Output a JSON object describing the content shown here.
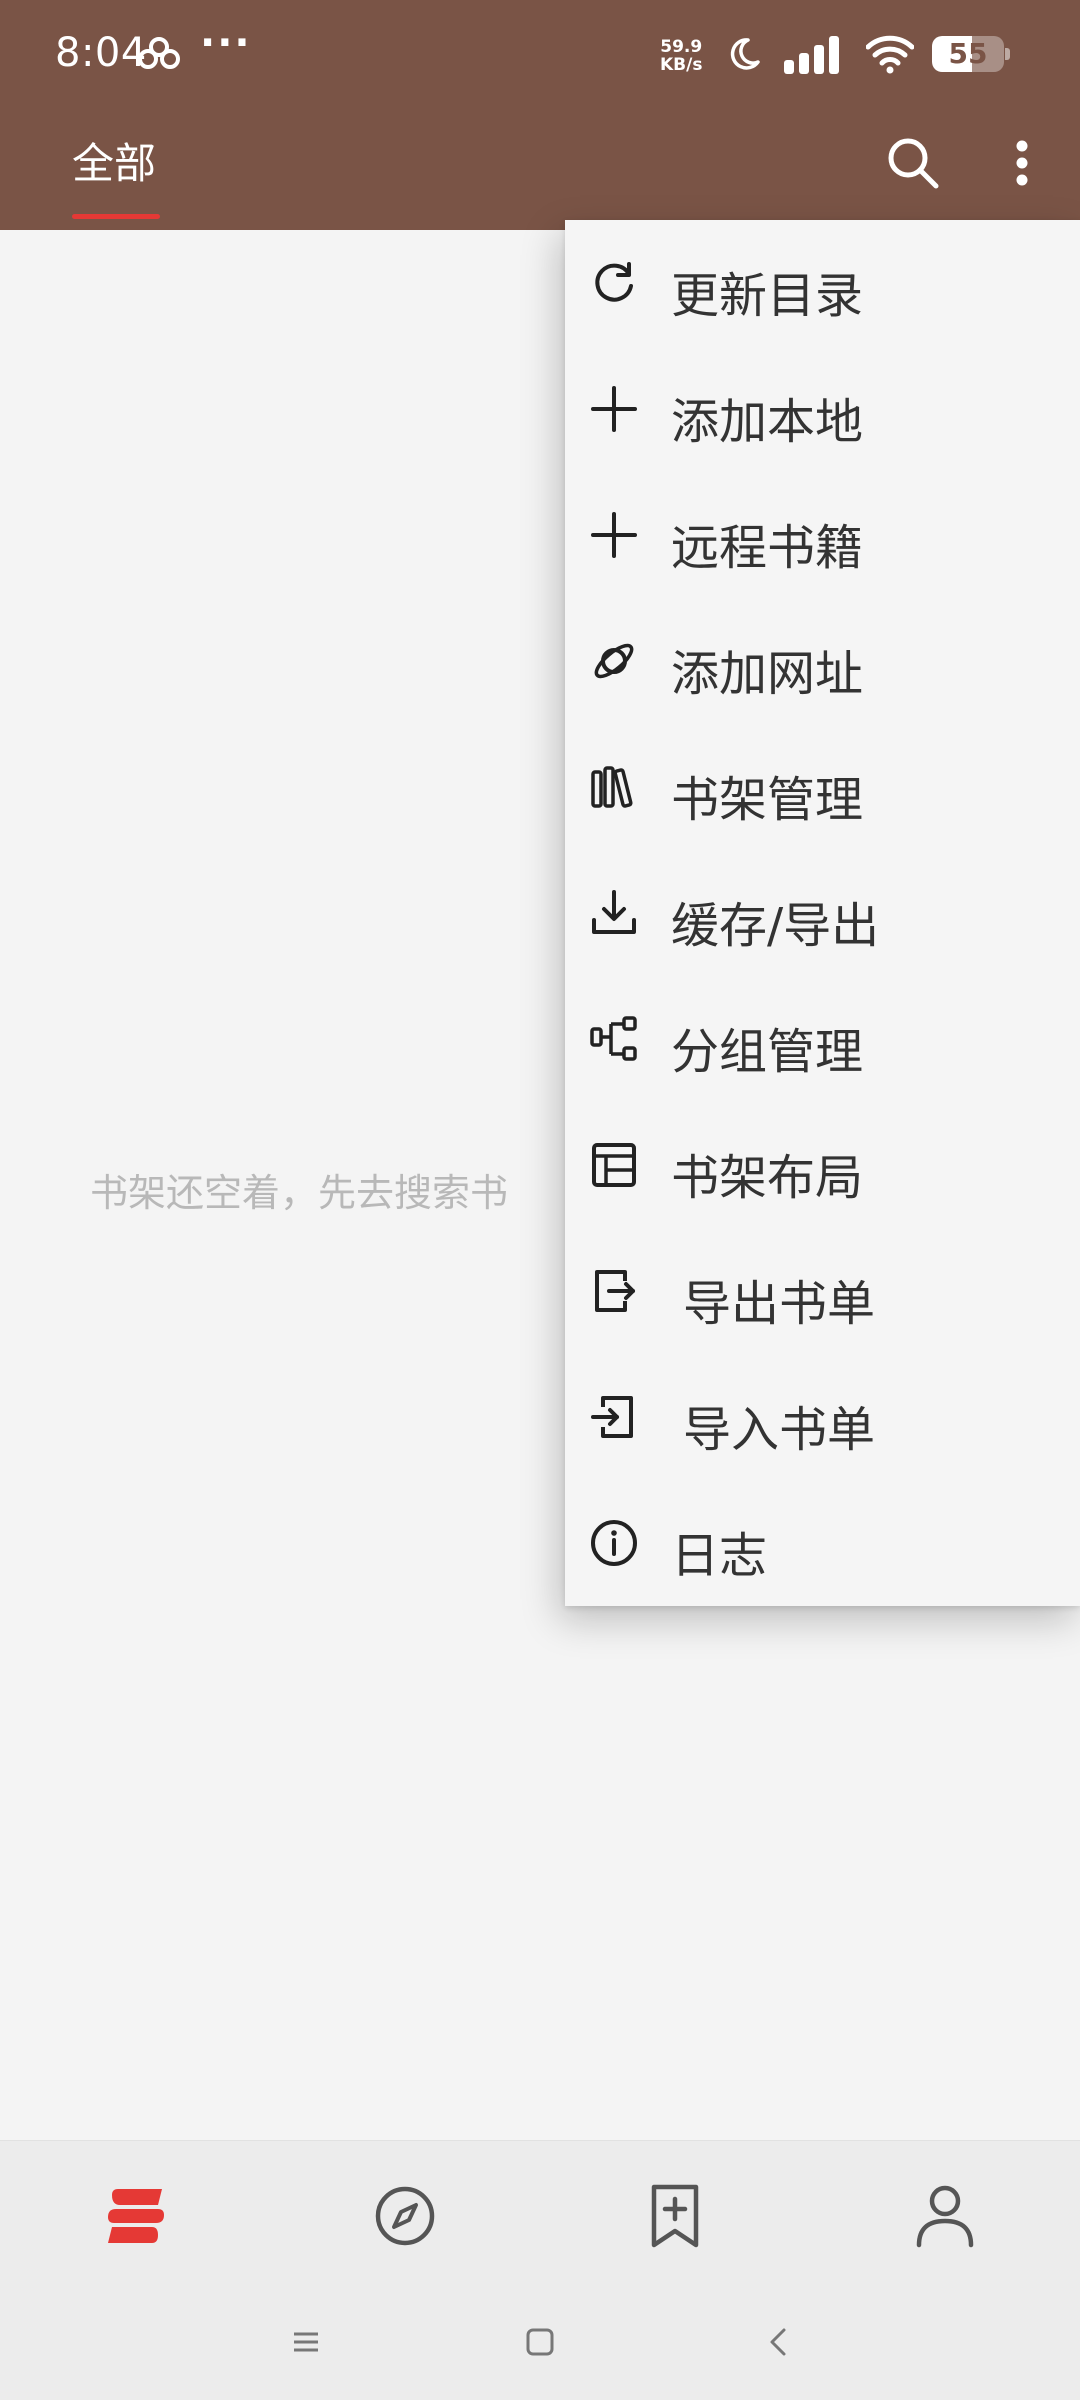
{
  "status_bar": {
    "time": "8:04",
    "dots": "···",
    "net_speed_value": "59.9",
    "net_speed_unit": "KB/s",
    "battery": "55",
    "battery_level": 0.55,
    "icons": [
      "cloud-icon",
      "moon-icon",
      "signal-icon",
      "wifi-icon",
      "battery-icon"
    ]
  },
  "toolbar": {
    "tab_label": "全部",
    "accent_color": "#e53935",
    "bar_color": "#7a5446",
    "icons": [
      "search-icon",
      "more-vert-icon"
    ]
  },
  "main": {
    "empty_message": "书架还空着，先去搜索书"
  },
  "menu": {
    "items": [
      {
        "label": "更新目录",
        "icon": "refresh-icon"
      },
      {
        "label": "添加本地",
        "icon": "plus-icon"
      },
      {
        "label": "远程书籍",
        "icon": "plus-icon"
      },
      {
        "label": "添加网址",
        "icon": "planet-icon"
      },
      {
        "label": "书架管理",
        "icon": "bookshelf-icon"
      },
      {
        "label": "缓存/导出",
        "icon": "download-icon"
      },
      {
        "label": "分组管理",
        "icon": "group-tree-icon"
      },
      {
        "label": "书架布局",
        "icon": "layout-icon"
      },
      {
        "label": "导出书单",
        "icon": "export-icon"
      },
      {
        "label": "导入书单",
        "icon": "import-icon"
      },
      {
        "label": "日志",
        "icon": "info-icon"
      }
    ]
  },
  "bottom_nav": {
    "items": [
      "bookshelf-nav-icon",
      "compass-icon",
      "bookmark-add-icon",
      "person-icon"
    ],
    "active_index": 0
  },
  "system_nav": {
    "items": [
      "menu-lines-icon",
      "home-square-icon",
      "back-chevron-icon"
    ]
  }
}
